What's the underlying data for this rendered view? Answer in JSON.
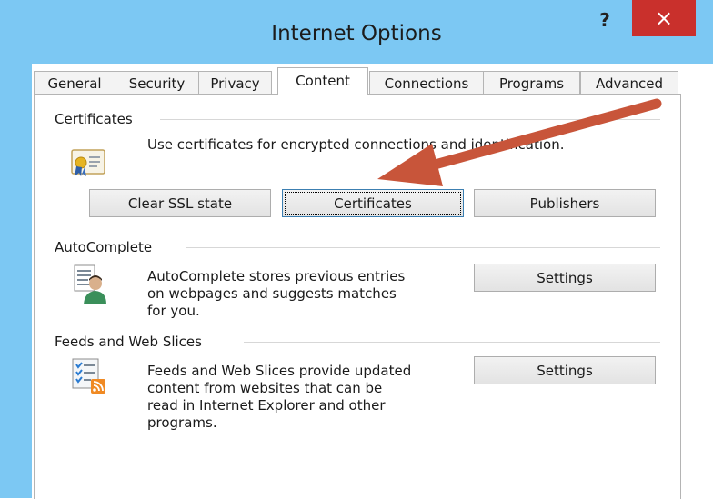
{
  "window": {
    "title": "Internet Options",
    "help_label": "?",
    "close_label": "×"
  },
  "tabs": [
    {
      "label": "General"
    },
    {
      "label": "Security"
    },
    {
      "label": "Privacy"
    },
    {
      "label": "Content",
      "active": true
    },
    {
      "label": "Connections"
    },
    {
      "label": "Programs"
    },
    {
      "label": "Advanced"
    }
  ],
  "certificates": {
    "group_label": "Certificates",
    "description": "Use certificates for encrypted connections and identification.",
    "icon": "certificate-icon",
    "buttons": {
      "clear_ssl": "Clear SSL state",
      "certificates": "Certificates",
      "publishers": "Publishers"
    }
  },
  "autocomplete": {
    "group_label": "AutoComplete",
    "description_lines": [
      "AutoComplete stores previous entries",
      "on webpages and suggests matches",
      "for you."
    ],
    "icon": "autocomplete-icon",
    "settings_label": "Settings"
  },
  "feeds": {
    "group_label": "Feeds and Web Slices",
    "description_lines": [
      "Feeds and Web Slices provide updated",
      "content from websites that can be",
      "read in Internet Explorer and other",
      "programs."
    ],
    "icon": "feeds-icon",
    "settings_label": "Settings"
  },
  "annotation": {
    "arrow_color": "#c8553a"
  }
}
